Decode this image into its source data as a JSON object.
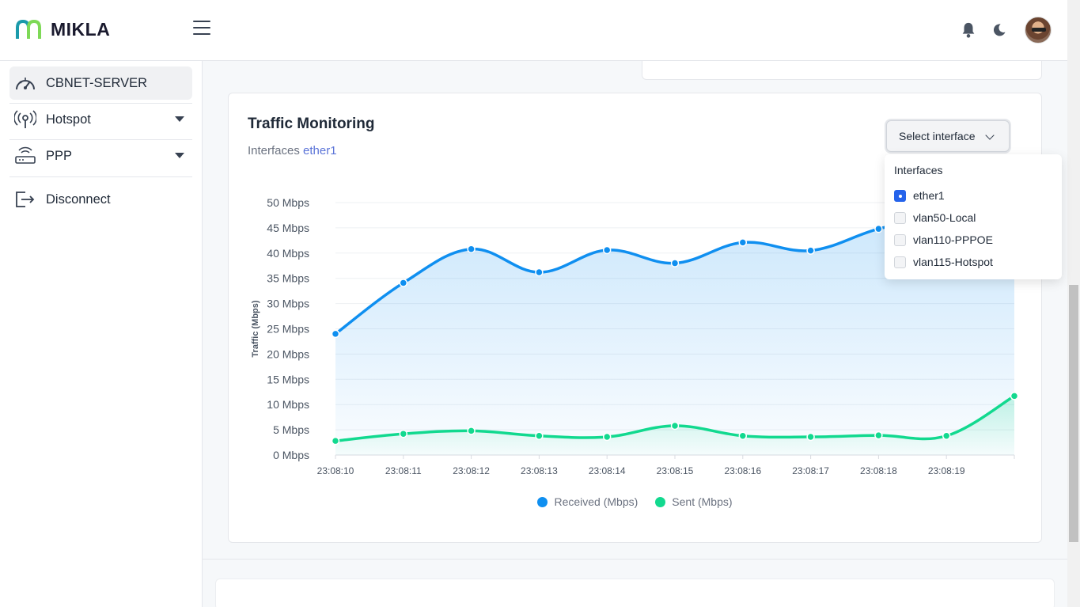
{
  "app": {
    "name": "MIKLA"
  },
  "sidebar": {
    "items": [
      {
        "label": "CBNET-SERVER",
        "icon": "speedometer-icon"
      },
      {
        "label": "Hotspot",
        "icon": "broadcast-icon"
      },
      {
        "label": "PPP",
        "icon": "router-icon"
      },
      {
        "label": "Disconnect",
        "icon": "logout-icon"
      }
    ]
  },
  "traffic": {
    "title": "Traffic Monitoring",
    "subtitle_prefix": "Interfaces",
    "selected_interface": "ether1",
    "select_button": "Select interface",
    "dropdown": {
      "header": "Interfaces",
      "options": [
        {
          "label": "ether1",
          "checked": true
        },
        {
          "label": "vlan50-Local",
          "checked": false
        },
        {
          "label": "vlan110-PPPOE",
          "checked": false
        },
        {
          "label": "vlan115-Hotspot",
          "checked": false
        }
      ]
    }
  },
  "chart_data": {
    "type": "area",
    "ylabel": "Traffic (Mbps)",
    "ylim": [
      0,
      50
    ],
    "yticks": [
      "0 Mbps",
      "5 Mbps",
      "10 Mbps",
      "15 Mbps",
      "20 Mbps",
      "25 Mbps",
      "30 Mbps",
      "35 Mbps",
      "40 Mbps",
      "45 Mbps",
      "50 Mbps"
    ],
    "x": [
      "23:08:10",
      "23:08:11",
      "23:08:12",
      "23:08:13",
      "23:08:14",
      "23:08:15",
      "23:08:16",
      "23:08:17",
      "23:08:18",
      "23:08:19",
      ""
    ],
    "series": [
      {
        "name": "Received (Mbps)",
        "color": "#0f8ff0",
        "values": [
          24.0,
          34.1,
          40.8,
          36.2,
          40.6,
          38.0,
          42.1,
          40.5,
          44.8,
          47.5,
          49.2
        ]
      },
      {
        "name": "Sent (Mbps)",
        "color": "#12d98f",
        "values": [
          2.8,
          4.2,
          4.8,
          3.8,
          3.6,
          5.8,
          3.8,
          3.6,
          3.9,
          3.8,
          11.7
        ]
      }
    ],
    "grid": true,
    "legend_position": "bottom-center"
  },
  "colors": {
    "accent": "#2563eb",
    "received": "#0f8ff0",
    "sent": "#12d98f"
  }
}
